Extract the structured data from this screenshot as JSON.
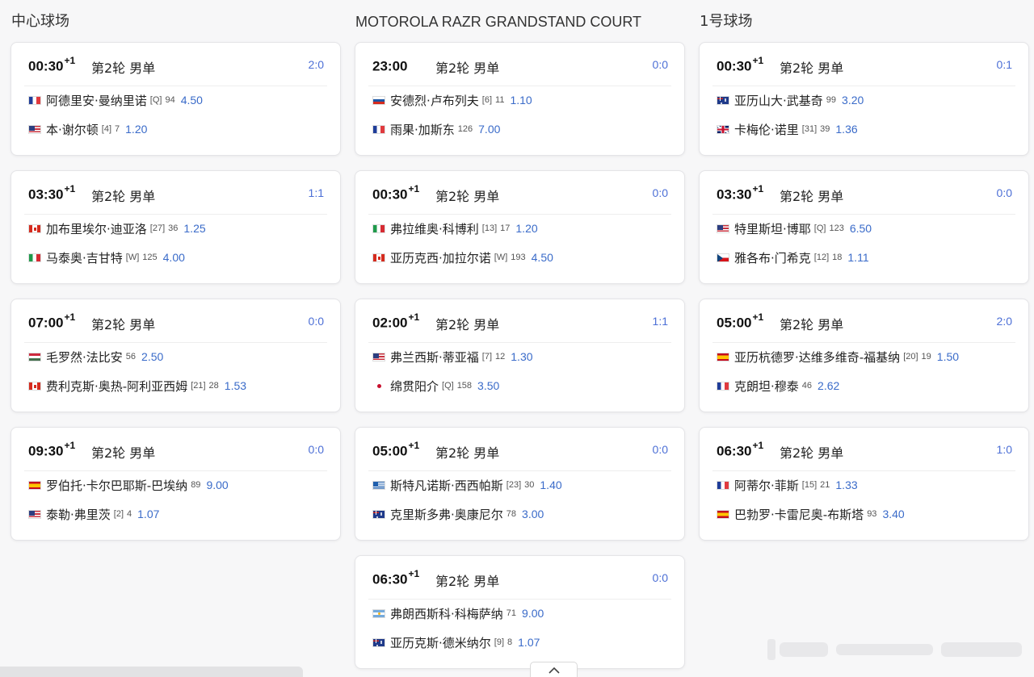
{
  "courts": [
    {
      "title": "中心球场",
      "matches": [
        {
          "time": "00:30",
          "day_offset": "+1",
          "round": "第2轮 男单",
          "score": "2:0",
          "players": [
            {
              "flag": "fr",
              "name": "阿德里安·曼纳里诺",
              "seed": "[Q]",
              "rank": "94",
              "odds": "4.50"
            },
            {
              "flag": "us",
              "name": "本·谢尔顿",
              "seed": "[4]",
              "rank": "7",
              "odds": "1.20"
            }
          ]
        },
        {
          "time": "03:30",
          "day_offset": "+1",
          "round": "第2轮 男单",
          "score": "1:1",
          "players": [
            {
              "flag": "ca",
              "name": "加布里埃尔·迪亚洛",
              "seed": "[27]",
              "rank": "36",
              "odds": "1.25"
            },
            {
              "flag": "it",
              "name": "马泰奥·吉甘特",
              "seed": "[W]",
              "rank": "125",
              "odds": "4.00"
            }
          ]
        },
        {
          "time": "07:00",
          "day_offset": "+1",
          "round": "第2轮 男单",
          "score": "0:0",
          "players": [
            {
              "flag": "hu",
              "name": "毛罗然·法比安",
              "seed": "",
              "rank": "56",
              "odds": "2.50"
            },
            {
              "flag": "ca",
              "name": "费利克斯·奥热-阿利亚西姆",
              "seed": "[21]",
              "rank": "28",
              "odds": "1.53"
            }
          ]
        },
        {
          "time": "09:30",
          "day_offset": "+1",
          "round": "第2轮 男单",
          "score": "0:0",
          "players": [
            {
              "flag": "es",
              "name": "罗伯托·卡尔巴耶斯-巴埃纳",
              "seed": "",
              "rank": "89",
              "odds": "9.00"
            },
            {
              "flag": "us",
              "name": "泰勒·弗里茨",
              "seed": "[2]",
              "rank": "4",
              "odds": "1.07"
            }
          ]
        }
      ]
    },
    {
      "title": "MOTOROLA RAZR GRANDSTAND COURT",
      "matches": [
        {
          "time": "23:00",
          "day_offset": "",
          "round": "第2轮 男单",
          "score": "0:0",
          "players": [
            {
              "flag": "ru",
              "name": "安德烈·卢布列夫",
              "seed": "[6]",
              "rank": "11",
              "odds": "1.10"
            },
            {
              "flag": "fr",
              "name": "雨果·加斯东",
              "seed": "",
              "rank": "126",
              "odds": "7.00"
            }
          ]
        },
        {
          "time": "00:30",
          "day_offset": "+1",
          "round": "第2轮 男单",
          "score": "0:0",
          "players": [
            {
              "flag": "it",
              "name": "弗拉维奥·科博利",
              "seed": "[13]",
              "rank": "17",
              "odds": "1.20"
            },
            {
              "flag": "ca",
              "name": "亚历克西·加拉尔诺",
              "seed": "[W]",
              "rank": "193",
              "odds": "4.50"
            }
          ]
        },
        {
          "time": "02:00",
          "day_offset": "+1",
          "round": "第2轮 男单",
          "score": "1:1",
          "players": [
            {
              "flag": "us",
              "name": "弗兰西斯·蒂亚福",
              "seed": "[7]",
              "rank": "12",
              "odds": "1.30"
            },
            {
              "flag": "jp",
              "name": "绵贯阳介",
              "seed": "[Q]",
              "rank": "158",
              "odds": "3.50"
            }
          ]
        },
        {
          "time": "05:00",
          "day_offset": "+1",
          "round": "第2轮 男单",
          "score": "0:0",
          "players": [
            {
              "flag": "gr",
              "name": "斯特凡诺斯·西西帕斯",
              "seed": "[23]",
              "rank": "30",
              "odds": "1.40"
            },
            {
              "flag": "au",
              "name": "克里斯多弗·奥康尼尔",
              "seed": "",
              "rank": "78",
              "odds": "3.00"
            }
          ]
        },
        {
          "time": "06:30",
          "day_offset": "+1",
          "round": "第2轮 男单",
          "score": "0:0",
          "players": [
            {
              "flag": "ar",
              "name": "弗朗西斯科·科梅萨纳",
              "seed": "",
              "rank": "71",
              "odds": "9.00"
            },
            {
              "flag": "au",
              "name": "亚历克斯·德米纳尔",
              "seed": "[9]",
              "rank": "8",
              "odds": "1.07"
            }
          ]
        }
      ]
    },
    {
      "title": "1号球场",
      "matches": [
        {
          "time": "00:30",
          "day_offset": "+1",
          "round": "第2轮 男单",
          "score": "0:1",
          "players": [
            {
              "flag": "au",
              "name": "亚历山大·武基奇",
              "seed": "",
              "rank": "99",
              "odds": "3.20"
            },
            {
              "flag": "gb",
              "name": "卡梅伦·诺里",
              "seed": "[31]",
              "rank": "39",
              "odds": "1.36"
            }
          ]
        },
        {
          "time": "03:30",
          "day_offset": "+1",
          "round": "第2轮 男单",
          "score": "0:0",
          "players": [
            {
              "flag": "us",
              "name": "特里斯坦·博耶",
              "seed": "[Q]",
              "rank": "123",
              "odds": "6.50"
            },
            {
              "flag": "cz",
              "name": "雅各布·门希克",
              "seed": "[12]",
              "rank": "18",
              "odds": "1.11"
            }
          ]
        },
        {
          "time": "05:00",
          "day_offset": "+1",
          "round": "第2轮 男单",
          "score": "2:0",
          "players": [
            {
              "flag": "es",
              "name": "亚历杭德罗·达维多维奇-福基纳",
              "seed": "[20]",
              "rank": "19",
              "odds": "1.50"
            },
            {
              "flag": "fr",
              "name": "克朗坦·穆泰",
              "seed": "",
              "rank": "46",
              "odds": "2.62"
            }
          ]
        },
        {
          "time": "06:30",
          "day_offset": "+1",
          "round": "第2轮 男单",
          "score": "1:0",
          "players": [
            {
              "flag": "fr",
              "name": "阿蒂尔·菲斯",
              "seed": "[15]",
              "rank": "21",
              "odds": "1.33"
            },
            {
              "flag": "es",
              "name": "巴勃罗·卡雷尼奥-布斯塔",
              "seed": "",
              "rank": "93",
              "odds": "3.40"
            }
          ]
        }
      ]
    }
  ],
  "icons": {
    "scroll_up": "chevron-up-icon"
  },
  "colors": {
    "score": "#4c6fd6",
    "odds": "#3a6bc9",
    "card_border": "#e4e4e7"
  }
}
